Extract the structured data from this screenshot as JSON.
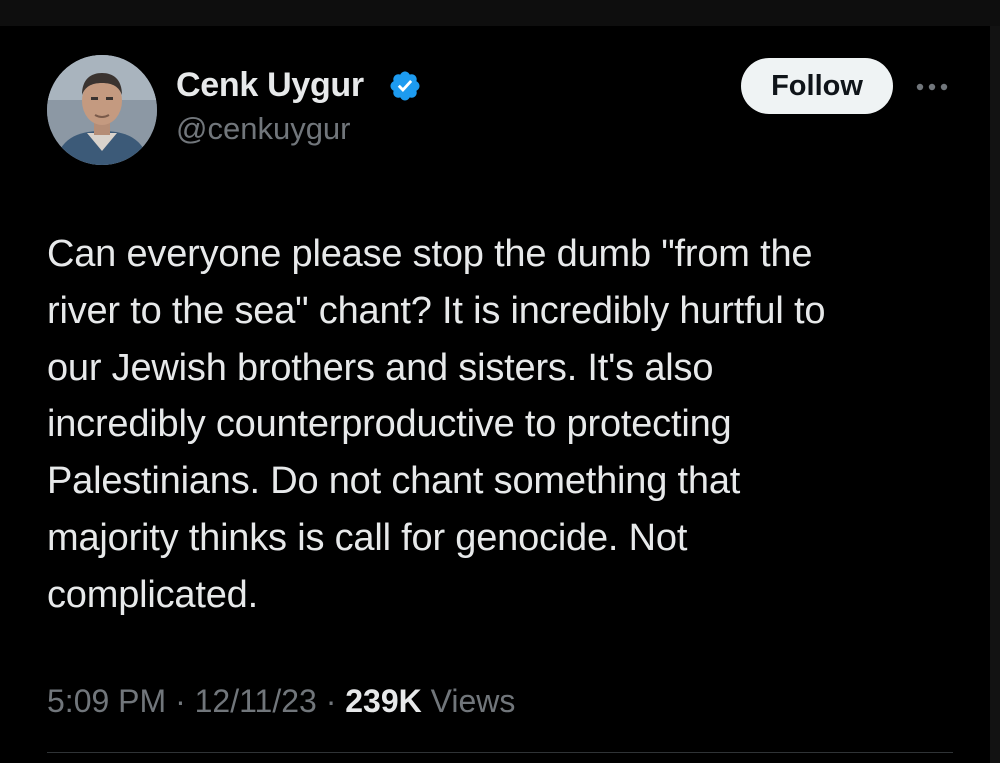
{
  "tweet": {
    "author": {
      "name": "Cenk Uygur",
      "handle": "@cenkuygur",
      "verified": true,
      "verified_color": "#1d9bf0"
    },
    "follow_label": "Follow",
    "more_icon": "more-horizontal-icon",
    "text": "Can everyone please stop the dumb \"from the\nriver to the sea\" chant? It is incredibly hurtful to\nour Jewish brothers and sisters. It's also\nincredibly counterproductive to protecting\nPalestinians. Do not chant something that\nmajority thinks is call for genocide. Not\ncomplicated.",
    "time": "5:09 PM",
    "date": "12/11/23",
    "separator": "·",
    "views_count": "239K",
    "views_label": "Views"
  },
  "colors": {
    "background": "#000000",
    "text_primary": "#e7e9ea",
    "text_secondary": "#71767b",
    "follow_button_bg": "#eff3f4",
    "follow_button_text": "#0f1419",
    "divider": "#2f3336"
  }
}
